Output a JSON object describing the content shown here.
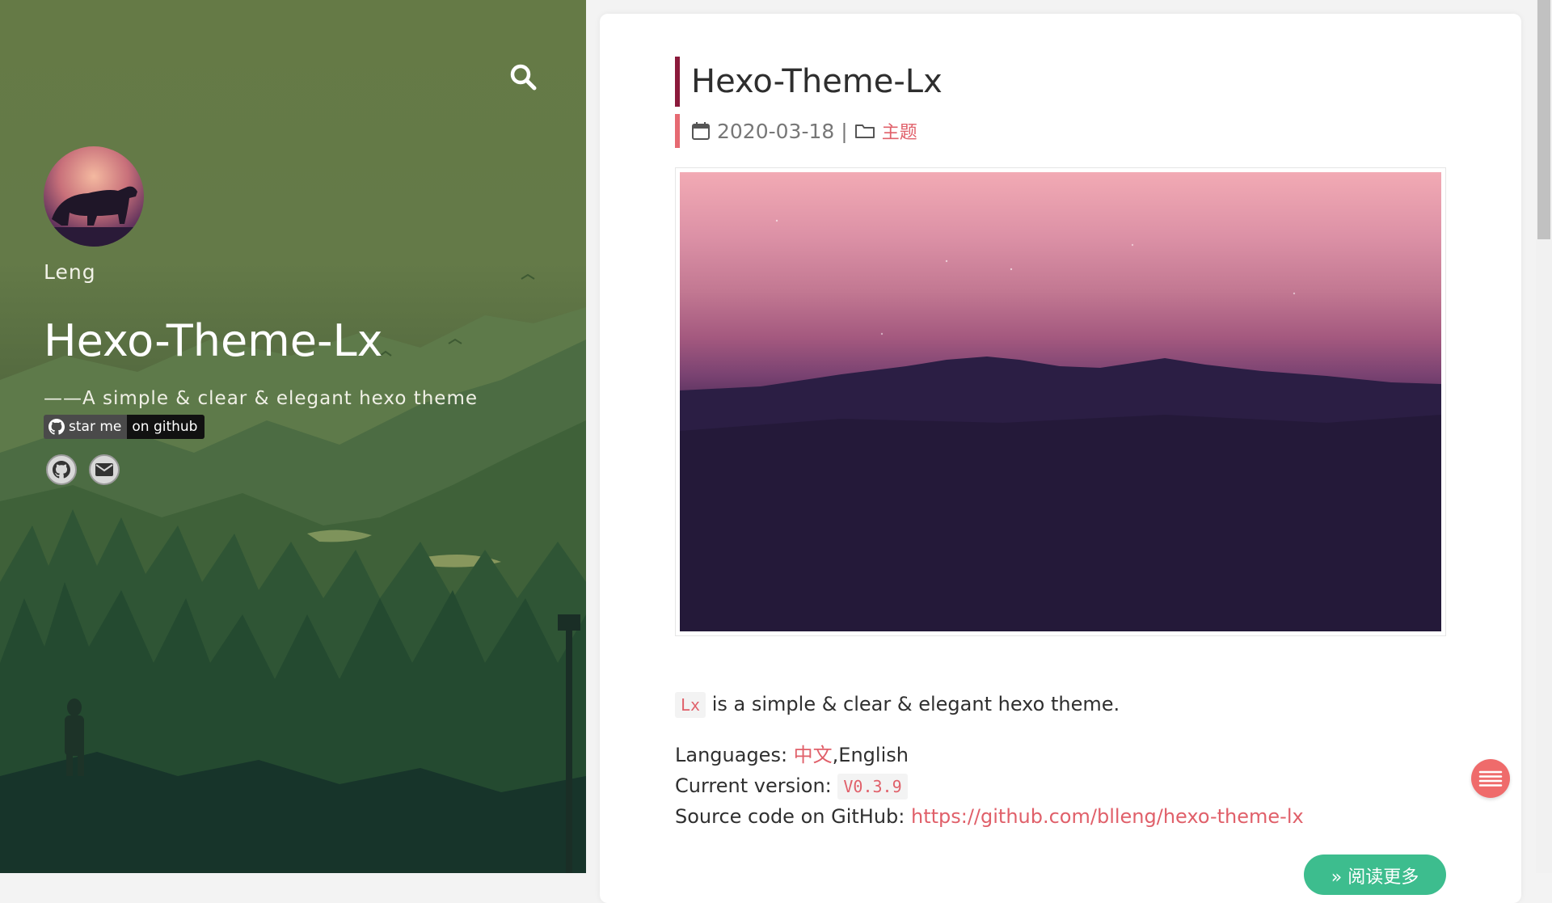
{
  "sidebar": {
    "author": "Leng",
    "title": "Hexo-Theme-Lx",
    "subtitle": "——A simple & clear & elegant hexo theme",
    "badge": {
      "left_label": "star me",
      "right_label": "on github"
    },
    "icons": [
      "search-icon",
      "github-icon",
      "email-icon"
    ]
  },
  "post": {
    "title": "Hexo-Theme-Lx",
    "date": "2020-03-18",
    "meta_separator": "|",
    "category": "主题",
    "code_tag": "Lx",
    "intro_rest": " is a simple & clear & elegant hexo theme.",
    "languages_label": "Languages: ",
    "languages_link": "中文",
    "languages_rest": ",English",
    "version_label": "Current version: ",
    "version_value": "V0.3.9",
    "source_label": "Source code on GitHub: ",
    "source_link": "https://github.com/blleng/hexo-theme-lx",
    "read_more": "» 阅读更多"
  },
  "colors": {
    "accent": "#e0606a",
    "title_bar": "#8b1a3b",
    "meta_bar": "#e66a72",
    "read_more": "#3dbd8e",
    "menu_button": "#ef6b6b"
  }
}
